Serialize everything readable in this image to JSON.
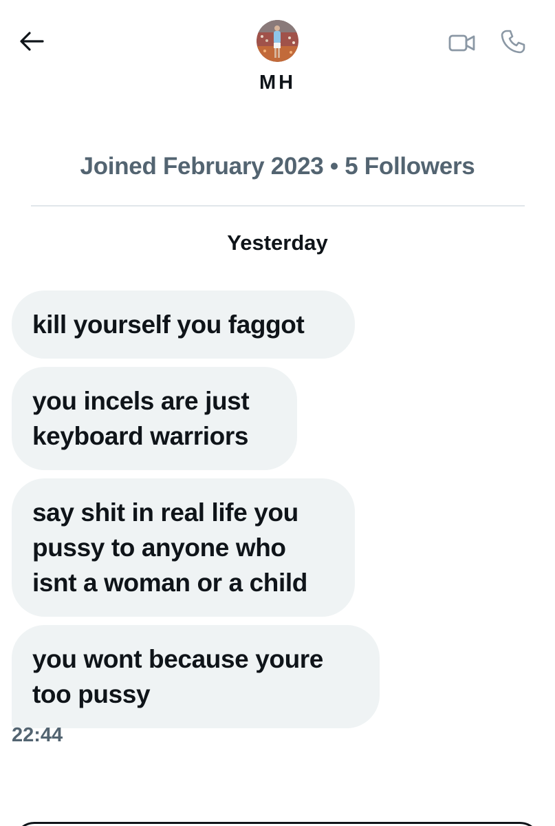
{
  "header": {
    "back_icon": "arrow-left-icon",
    "username": "MH",
    "avatar_icon": "profile-photo",
    "video_icon": "video-camera-icon",
    "phone_icon": "phone-icon"
  },
  "profile": {
    "meta": "Joined February 2023 • 5 Followers"
  },
  "conversation": {
    "date_separator": "Yesterday",
    "messages": [
      {
        "text": "kill yourself you faggot"
      },
      {
        "text": "you incels are just keyboard warriors"
      },
      {
        "text": "say shit in real life you pussy to anyone who isnt a woman or a child"
      },
      {
        "text": "you wont because youre too pussy"
      }
    ],
    "timestamp": "22:44"
  },
  "colors": {
    "bubble_bg": "#eff3f4",
    "text_primary": "#0f1419",
    "text_secondary": "#536471",
    "icon_gray": "#8b98a5"
  }
}
